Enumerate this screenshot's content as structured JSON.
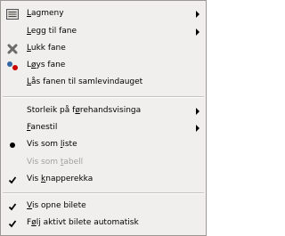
{
  "menu": {
    "items": {
      "tab_menu": {
        "pre": "",
        "ul": "L",
        "post": "agmeny",
        "icon": "tab-menu-icon"
      },
      "add_tab": {
        "pre": "",
        "ul": "L",
        "post": "egg til fane"
      },
      "close_tab": {
        "pre": "",
        "ul": "L",
        "post": "ukk fane",
        "icon": "close-icon"
      },
      "detach_tab": {
        "pre": "L",
        "ul": "ø",
        "post": "ys fane",
        "icon": "detach-icon"
      },
      "lock_tab": {
        "pre": "",
        "ul": "L",
        "post": "ås fanen til samlevindauget"
      },
      "preview_size": {
        "pre": "Storleik på f",
        "ul": "ø",
        "post": "rehandsvisinga"
      },
      "tab_style": {
        "pre": "",
        "ul": "F",
        "post": "anestil"
      },
      "view_as_list": {
        "pre": "Vis som ",
        "ul": "l",
        "post": "iste"
      },
      "view_as_grid": {
        "pre": "Vis som ",
        "ul": "t",
        "post": "abell"
      },
      "show_button_bar": {
        "pre": "Vis ",
        "ul": "k",
        "post": "napperekka"
      },
      "show_image_selection": {
        "pre": "",
        "ul": "V",
        "post": "is opne bilete"
      },
      "auto_follow_active_image": {
        "pre": "F",
        "ul": "ø",
        "post": "lj aktivt bilete automatisk"
      }
    }
  }
}
